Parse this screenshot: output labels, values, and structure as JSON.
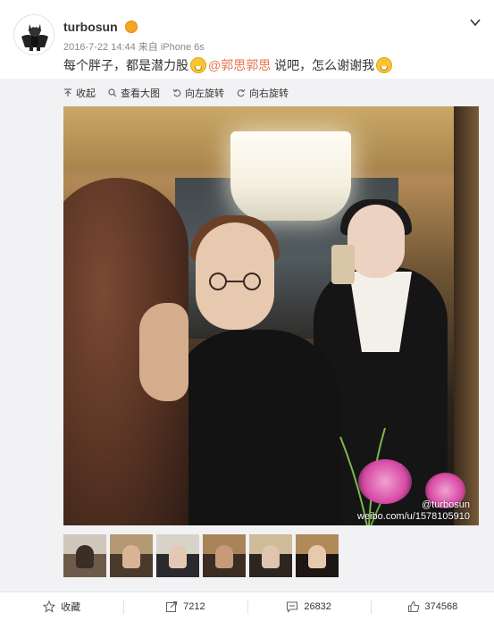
{
  "header": {
    "username": "turbosun",
    "timestamp": "2016-7-22 14:44",
    "source": "来自 iPhone 6s",
    "icons": {
      "avatar": "batman-figure-avatar",
      "badge": "vip-badge-icon",
      "menu": "chevron-down-icon"
    }
  },
  "post": {
    "text_before": "每个胖子，都是潜力股",
    "mention": "@郭思郭思",
    "text_after": "说吧，怎么谢谢我",
    "mention_color": "#eb7350"
  },
  "toolbar": {
    "collapse_label": "收起",
    "view_large_label": "查看大图",
    "rotate_left_label": "向左旋转",
    "rotate_right_label": "向右旋转"
  },
  "photo": {
    "watermark_line1": "@turbosun",
    "watermark_line2": "weibo.com/u/1578105910"
  },
  "thumbnails": {
    "count": 6,
    "active_index": 5
  },
  "actions": {
    "favorite_label": "收藏",
    "repost_count": "7212",
    "comment_count": "26832",
    "like_count": "374568"
  },
  "colors": {
    "accent_orange": "#f48e00",
    "text": "#333333",
    "meta": "#888888",
    "panel_bg": "#f2f2f5"
  }
}
